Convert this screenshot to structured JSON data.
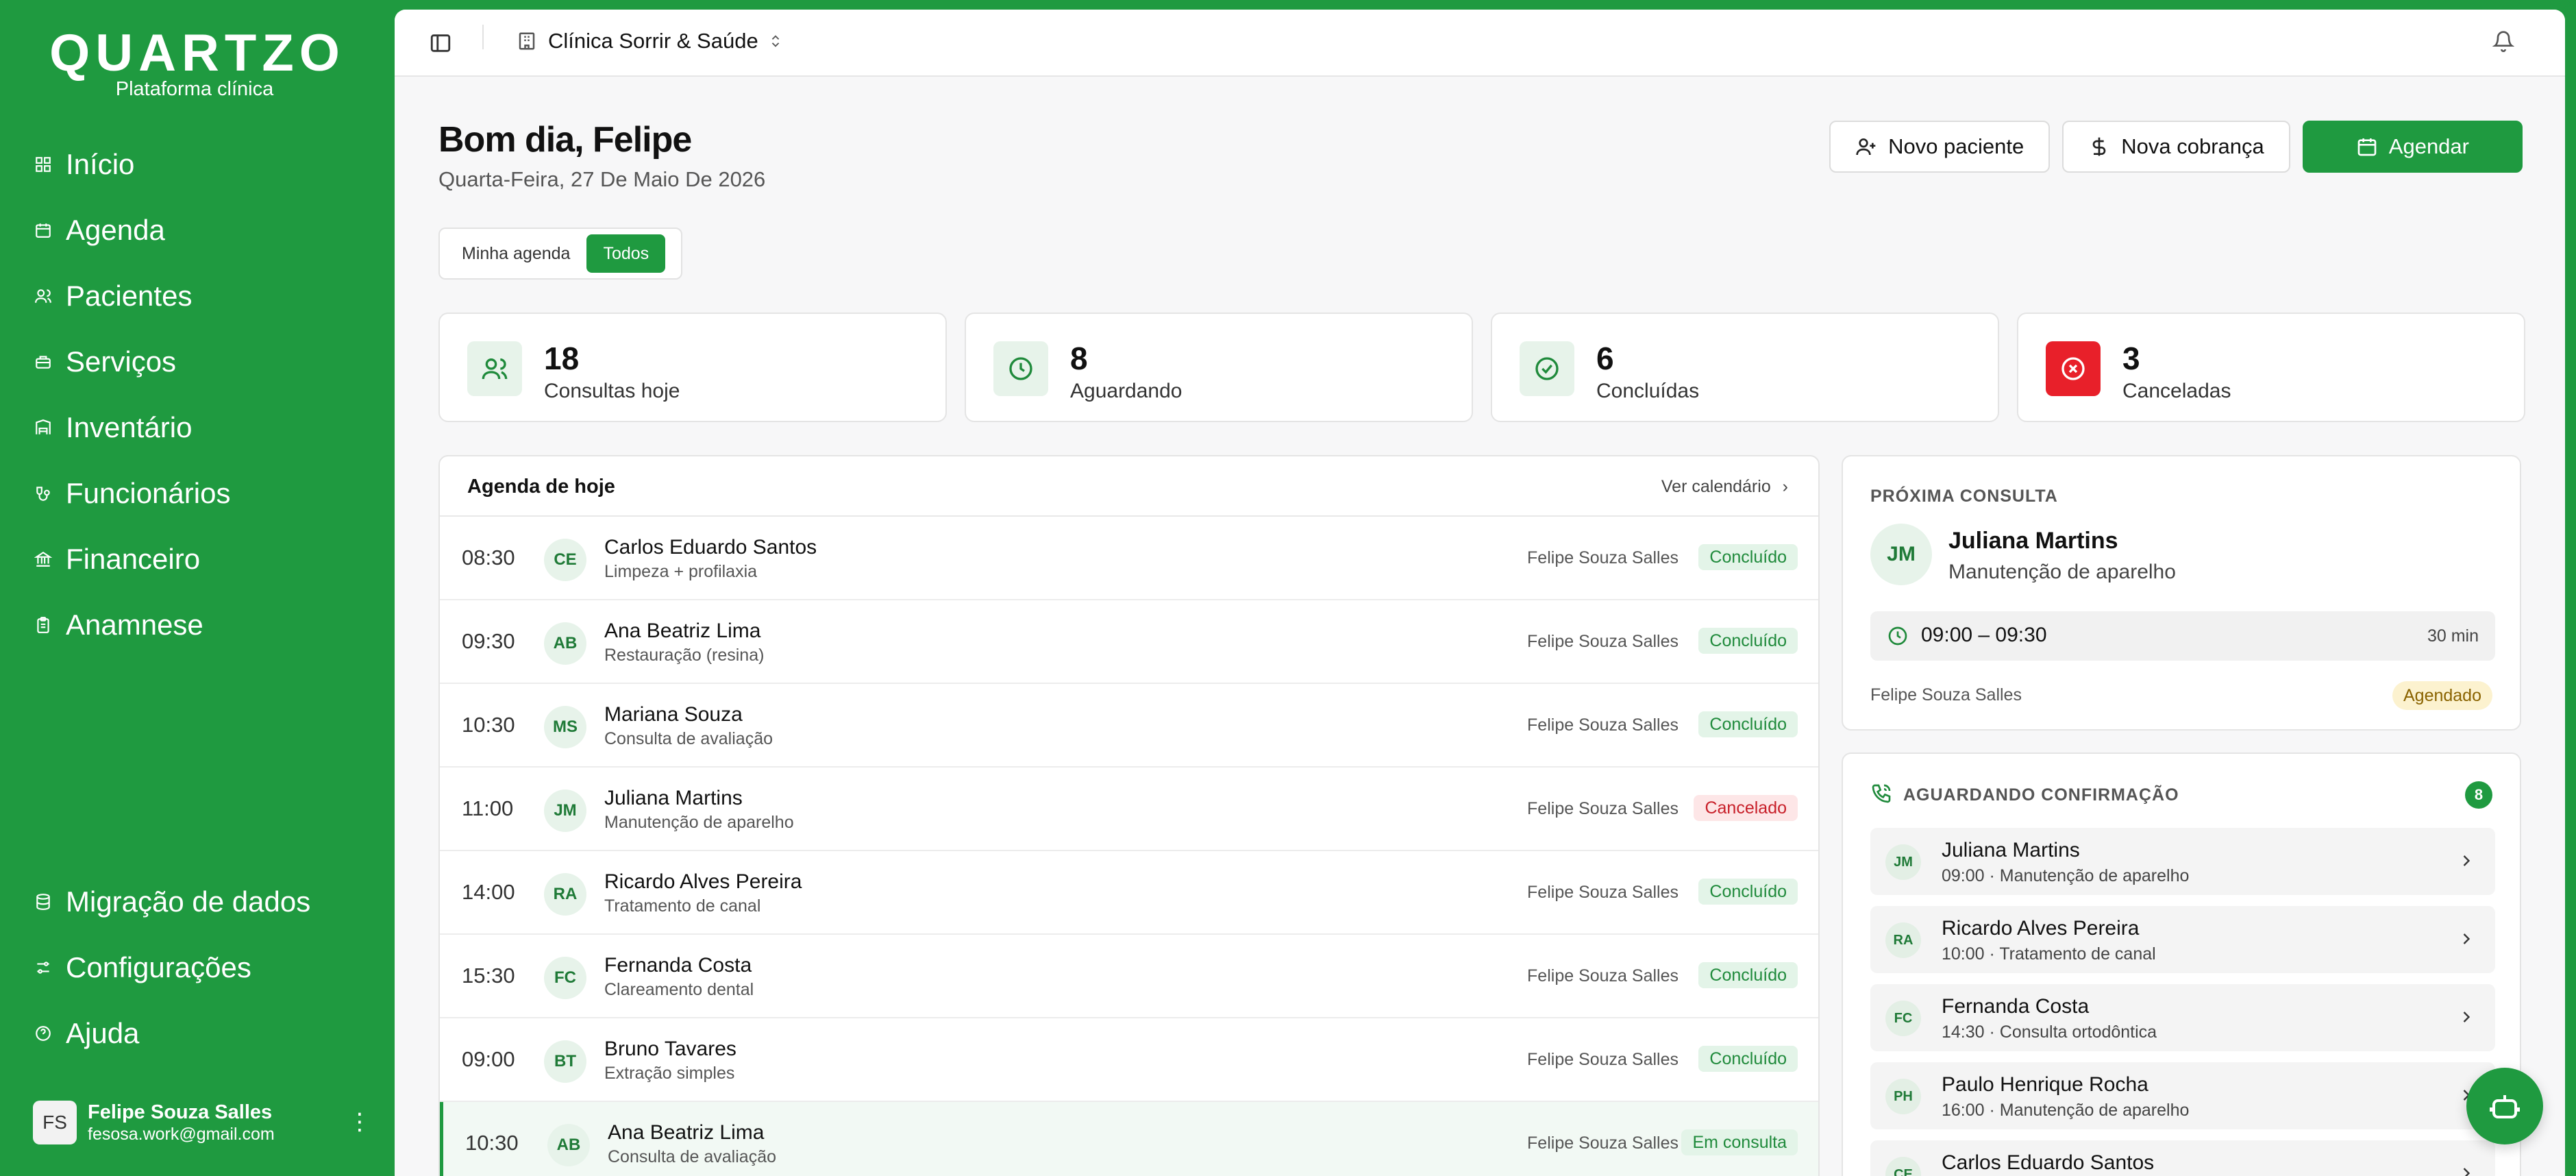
{
  "brand": {
    "name": "QUARTZO",
    "subtitle": "Plataforma clínica"
  },
  "nav_main": [
    {
      "label": "Início",
      "icon": "grid-icon"
    },
    {
      "label": "Agenda",
      "icon": "calendar-icon"
    },
    {
      "label": "Pacientes",
      "icon": "users-icon"
    },
    {
      "label": "Serviços",
      "icon": "briefcase-icon"
    },
    {
      "label": "Inventário",
      "icon": "inventory-icon"
    },
    {
      "label": "Funcionários",
      "icon": "staff-icon"
    },
    {
      "label": "Financeiro",
      "icon": "bank-icon"
    },
    {
      "label": "Anamnese",
      "icon": "clipboard-icon"
    }
  ],
  "nav_bottom": [
    {
      "label": "Migração de dados",
      "icon": "database-icon"
    },
    {
      "label": "Configurações",
      "icon": "settings-icon"
    },
    {
      "label": "Ajuda",
      "icon": "help-icon"
    }
  ],
  "user": {
    "initials": "FS",
    "name": "Felipe Souza Salles",
    "email": "fesosa.work@gmail.com"
  },
  "topbar": {
    "clinic": "Clínica Sorrir & Saúde"
  },
  "header": {
    "greeting": "Bom dia, Felipe",
    "date": "Quarta-Feira, 27 De Maio De 2026",
    "actions": {
      "new_patient": "Novo paciente",
      "new_charge": "Nova cobrança",
      "schedule": "Agendar"
    }
  },
  "filter": {
    "options": [
      "Minha agenda",
      "Todos"
    ],
    "selected": "Todos"
  },
  "stats": [
    {
      "value": "18",
      "label": "Consultas hoje"
    },
    {
      "value": "8",
      "label": "Aguardando"
    },
    {
      "value": "6",
      "label": "Concluídas"
    },
    {
      "value": "3",
      "label": "Canceladas"
    }
  ],
  "agenda": {
    "title": "Agenda de hoje",
    "link": "Ver calendário",
    "rows": [
      {
        "time": "08:30",
        "initials": "CE",
        "name": "Carlos Eduardo Santos",
        "procedure": "Limpeza + profilaxia",
        "professional": "Felipe Souza Salles",
        "status": "Concluído"
      },
      {
        "time": "09:30",
        "initials": "AB",
        "name": "Ana Beatriz Lima",
        "procedure": "Restauração (resina)",
        "professional": "Felipe Souza Salles",
        "status": "Concluído"
      },
      {
        "time": "10:30",
        "initials": "MS",
        "name": "Mariana Souza",
        "procedure": "Consulta de avaliação",
        "professional": "Felipe Souza Salles",
        "status": "Concluído"
      },
      {
        "time": "11:00",
        "initials": "JM",
        "name": "Juliana Martins",
        "procedure": "Manutenção de aparelho",
        "professional": "Felipe Souza Salles",
        "status": "Cancelado"
      },
      {
        "time": "14:00",
        "initials": "RA",
        "name": "Ricardo Alves Pereira",
        "procedure": "Tratamento de canal",
        "professional": "Felipe Souza Salles",
        "status": "Concluído"
      },
      {
        "time": "15:30",
        "initials": "FC",
        "name": "Fernanda Costa",
        "procedure": "Clareamento dental",
        "professional": "Felipe Souza Salles",
        "status": "Concluído"
      },
      {
        "time": "09:00",
        "initials": "BT",
        "name": "Bruno Tavares",
        "procedure": "Extração simples",
        "professional": "Felipe Souza Salles",
        "status": "Concluído"
      },
      {
        "time": "10:30",
        "initials": "AB",
        "name": "Ana Beatriz Lima",
        "procedure": "Consulta de avaliação",
        "professional": "Felipe Souza Salles",
        "status": "Em consulta"
      }
    ]
  },
  "next": {
    "caption": "PRÓXIMA CONSULTA",
    "initials": "JM",
    "name": "Juliana Martins",
    "procedure": "Manutenção de aparelho",
    "slot": "09:00 – 09:30",
    "duration": "30 min",
    "professional": "Felipe Souza Salles",
    "status": "Agendado"
  },
  "waiting": {
    "caption": "AGUARDANDO CONFIRMAÇÃO",
    "count": "8",
    "items": [
      {
        "initials": "JM",
        "name": "Juliana Martins",
        "detail": "09:00 · Manutenção de aparelho"
      },
      {
        "initials": "RA",
        "name": "Ricardo Alves Pereira",
        "detail": "10:00 · Tratamento de canal"
      },
      {
        "initials": "FC",
        "name": "Fernanda Costa",
        "detail": "14:30 · Consulta ortodôntica"
      },
      {
        "initials": "PH",
        "name": "Paulo Henrique Rocha",
        "detail": "16:00 · Manutenção de aparelho"
      },
      {
        "initials": "CE",
        "name": "Carlos Eduardo Santos",
        "detail": ""
      }
    ]
  },
  "colors": {
    "brand_green": "#1f9a40",
    "danger_red": "#e8202a",
    "background": "#f7f7f8"
  }
}
